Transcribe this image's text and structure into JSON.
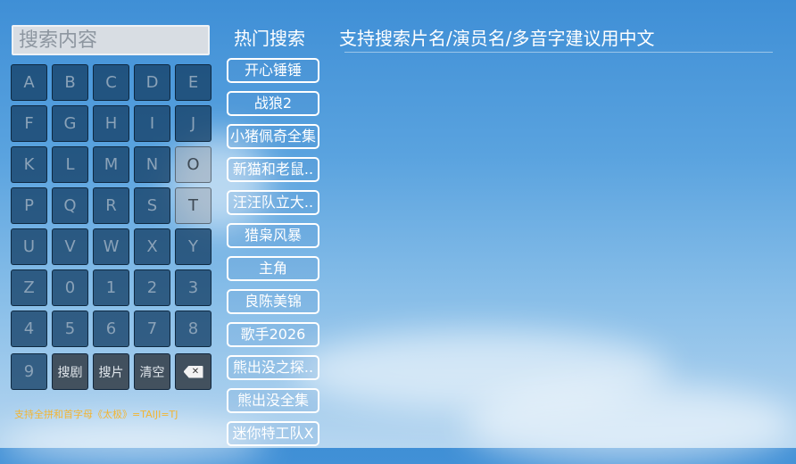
{
  "search": {
    "placeholder": "搜索内容"
  },
  "keyboard": {
    "rows": [
      [
        "A",
        "B",
        "C",
        "D",
        "E"
      ],
      [
        "F",
        "G",
        "H",
        "I",
        "J"
      ],
      [
        "K",
        "L",
        "M",
        "N",
        "O"
      ],
      [
        "P",
        "Q",
        "R",
        "S",
        "T"
      ],
      [
        "U",
        "V",
        "W",
        "X",
        "Y"
      ],
      [
        "Z",
        "0",
        "1",
        "2",
        "3"
      ],
      [
        "4",
        "5",
        "6",
        "7",
        "8"
      ]
    ],
    "bottom": {
      "nine": "9",
      "search_drama": "搜剧",
      "search_movie": "搜片",
      "clear": "清空",
      "backspace_icon": "backspace-icon"
    }
  },
  "hint": "支持全拼和首字母《太极》=TAIJI=TJ",
  "hot": {
    "title": "热门搜索",
    "items": [
      "开心锤锤",
      "战狼2",
      "小猪佩奇全集",
      "新猫和老鼠..",
      "汪汪队立大..",
      "猎枭风暴",
      "主角",
      "良陈美锦",
      "歌手2026",
      "熊出没之探..",
      "熊出没全集",
      "迷你特工队X"
    ]
  },
  "header_hint": "支持搜索片名/演员名/多音字建议用中文"
}
